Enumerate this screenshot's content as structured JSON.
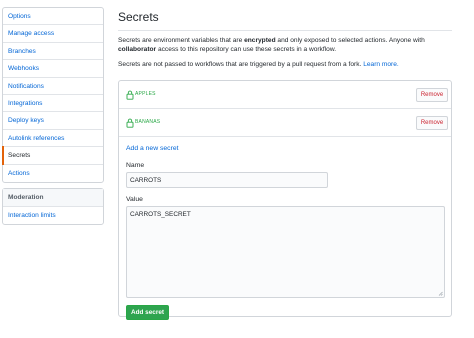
{
  "sidebar": {
    "items": [
      {
        "label": "Options"
      },
      {
        "label": "Manage access"
      },
      {
        "label": "Branches"
      },
      {
        "label": "Webhooks"
      },
      {
        "label": "Notifications"
      },
      {
        "label": "Integrations"
      },
      {
        "label": "Deploy keys"
      },
      {
        "label": "Autolink references"
      },
      {
        "label": "Secrets"
      },
      {
        "label": "Actions"
      }
    ],
    "moderation_heading": "Moderation",
    "moderation_items": [
      {
        "label": "Interaction limits"
      }
    ]
  },
  "main": {
    "title": "Secrets",
    "description_part1": "Secrets are environment variables that are ",
    "description_bold1": "encrypted",
    "description_part2": " and only exposed to selected actions. Anyone with ",
    "description_bold2": "collaborator",
    "description_part3": " access to this repository can use these secrets in a workflow.",
    "note": "Secrets are not passed to workflows that are triggered by a pull request from a fork.",
    "learn_more": "Learn more.",
    "secrets": [
      {
        "name": "APPLES",
        "remove_label": "Remove"
      },
      {
        "name": "BANANAS",
        "remove_label": "Remove"
      }
    ],
    "add_new_link": "Add a new secret",
    "name_label": "Name",
    "name_value": "CARROTS",
    "value_label": "Value",
    "value_value": "CARROTS_SECRET",
    "add_button": "Add secret"
  },
  "colors": {
    "link": "#0366d6",
    "selected_accent": "#e36209",
    "secret_name": "#28a745",
    "remove_text": "#cb2431",
    "primary_button": "#2ea44f"
  }
}
